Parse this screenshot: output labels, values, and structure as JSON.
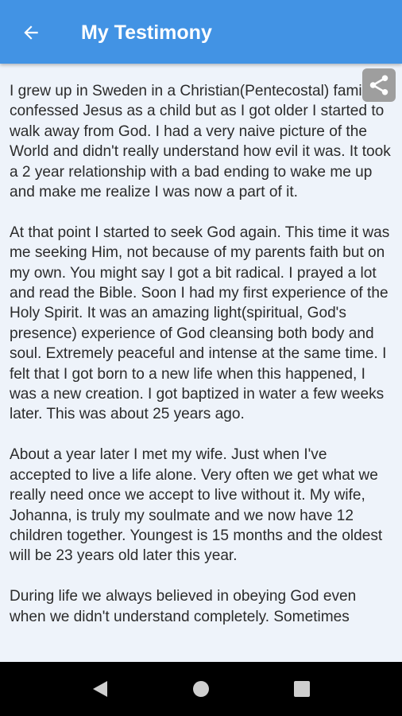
{
  "app_bar": {
    "title": "My Testimony",
    "back_icon": "arrow-back-icon",
    "color": "#4293e4"
  },
  "share": {
    "icon": "share-icon"
  },
  "article": {
    "paragraphs": [
      "I grew up in Sweden in a Christian(Pentecostal) family. I confessed Jesus as a child but as I got older I started to walk away from God. I had a very naive picture of the World and didn't really understand how evil it was. It took a 2 year relationship with a bad ending to wake me up and make me realize I was now a part of it.",
      "At that point I started to seek God again. This time it was me seeking Him, not because of my parents faith but on my own. You might say I got a bit radical. I prayed a lot and read the Bible. Soon I had my first experience of the Holy Spirit. It was an amazing light(spiritual, God's presence) experience of God cleansing both body and soul. Extremely peaceful and intense at the same time. I felt that I got born to a new life when this happened, I was a new creation. I got baptized in water a few weeks later. This was about 25 years ago.",
      "About a year later I met my wife. Just when I've accepted to live a life alone. Very often we get what we really need once we accept to live without it. My wife, Johanna, is truly my soulmate and we now have 12 children together. Youngest is 15 months and the oldest will be 23 years old later this year.",
      "During life we always believed in obeying God even when we didn't understand completely. Sometimes"
    ]
  },
  "nav_bar": {
    "back_icon": "nav-back-icon",
    "home_icon": "nav-home-icon",
    "recents_icon": "nav-recents-icon"
  }
}
